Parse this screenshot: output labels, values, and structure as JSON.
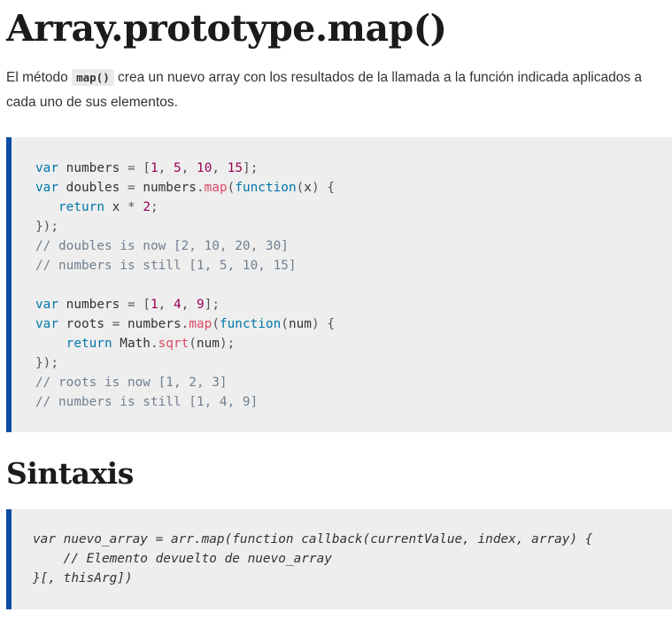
{
  "page": {
    "title": "Array.prototype.map()",
    "intro_before": "El método ",
    "intro_code": "map()",
    "intro_after": " crea un nuevo array con los resultados de la llamada a la función indicada aplicados a cada uno de sus elementos."
  },
  "example": {
    "lines": [
      [
        [
          "kw",
          "var"
        ],
        [
          "t",
          " numbers "
        ],
        [
          "punc",
          "="
        ],
        [
          "t",
          " "
        ],
        [
          "punc",
          "["
        ],
        [
          "num",
          "1"
        ],
        [
          "punc",
          ","
        ],
        [
          "t",
          " "
        ],
        [
          "num",
          "5"
        ],
        [
          "punc",
          ","
        ],
        [
          "t",
          " "
        ],
        [
          "num",
          "10"
        ],
        [
          "punc",
          ","
        ],
        [
          "t",
          " "
        ],
        [
          "num",
          "15"
        ],
        [
          "punc",
          "];"
        ]
      ],
      [
        [
          "kw",
          "var"
        ],
        [
          "t",
          " doubles "
        ],
        [
          "punc",
          "="
        ],
        [
          "t",
          " numbers"
        ],
        [
          "punc",
          "."
        ],
        [
          "fn",
          "map"
        ],
        [
          "punc",
          "("
        ],
        [
          "kw",
          "function"
        ],
        [
          "punc",
          "("
        ],
        [
          "t",
          "x"
        ],
        [
          "punc",
          ")"
        ],
        [
          "t",
          " "
        ],
        [
          "punc",
          "{"
        ]
      ],
      [
        [
          "t",
          "   "
        ],
        [
          "kw",
          "return"
        ],
        [
          "t",
          " x "
        ],
        [
          "punc",
          "*"
        ],
        [
          "t",
          " "
        ],
        [
          "num",
          "2"
        ],
        [
          "punc",
          ";"
        ]
      ],
      [
        [
          "punc",
          "});"
        ]
      ],
      [
        [
          "cm",
          "// doubles is now [2, 10, 20, 30]"
        ]
      ],
      [
        [
          "cm",
          "// numbers is still [1, 5, 10, 15]"
        ]
      ],
      [
        [
          "t",
          ""
        ]
      ],
      [
        [
          "kw",
          "var"
        ],
        [
          "t",
          " numbers "
        ],
        [
          "punc",
          "="
        ],
        [
          "t",
          " "
        ],
        [
          "punc",
          "["
        ],
        [
          "num",
          "1"
        ],
        [
          "punc",
          ","
        ],
        [
          "t",
          " "
        ],
        [
          "num",
          "4"
        ],
        [
          "punc",
          ","
        ],
        [
          "t",
          " "
        ],
        [
          "num",
          "9"
        ],
        [
          "punc",
          "];"
        ]
      ],
      [
        [
          "kw",
          "var"
        ],
        [
          "t",
          " roots "
        ],
        [
          "punc",
          "="
        ],
        [
          "t",
          " numbers"
        ],
        [
          "punc",
          "."
        ],
        [
          "fn",
          "map"
        ],
        [
          "punc",
          "("
        ],
        [
          "kw",
          "function"
        ],
        [
          "punc",
          "("
        ],
        [
          "t",
          "num"
        ],
        [
          "punc",
          ")"
        ],
        [
          "t",
          " "
        ],
        [
          "punc",
          "{"
        ]
      ],
      [
        [
          "t",
          "    "
        ],
        [
          "kw",
          "return"
        ],
        [
          "t",
          " Math"
        ],
        [
          "punc",
          "."
        ],
        [
          "fn",
          "sqrt"
        ],
        [
          "punc",
          "("
        ],
        [
          "t",
          "num"
        ],
        [
          "punc",
          ");"
        ]
      ],
      [
        [
          "punc",
          "});"
        ]
      ],
      [
        [
          "cm",
          "// roots is now [1, 2, 3]"
        ]
      ],
      [
        [
          "cm",
          "// numbers is still [1, 4, 9]"
        ]
      ]
    ]
  },
  "syntax": {
    "heading": "Sintaxis",
    "lines": [
      "var nuevo_array = arr.map(function callback(currentValue, index, array) {",
      "    // Elemento devuelto de nuevo_array",
      "}[, thisArg])"
    ]
  },
  "colors": {
    "accent_border": "#0b4da2",
    "keyword": "#0077aa",
    "function": "#dd4a68",
    "number": "#990055",
    "comment": "#708090",
    "code_background": "#eeeeee"
  }
}
